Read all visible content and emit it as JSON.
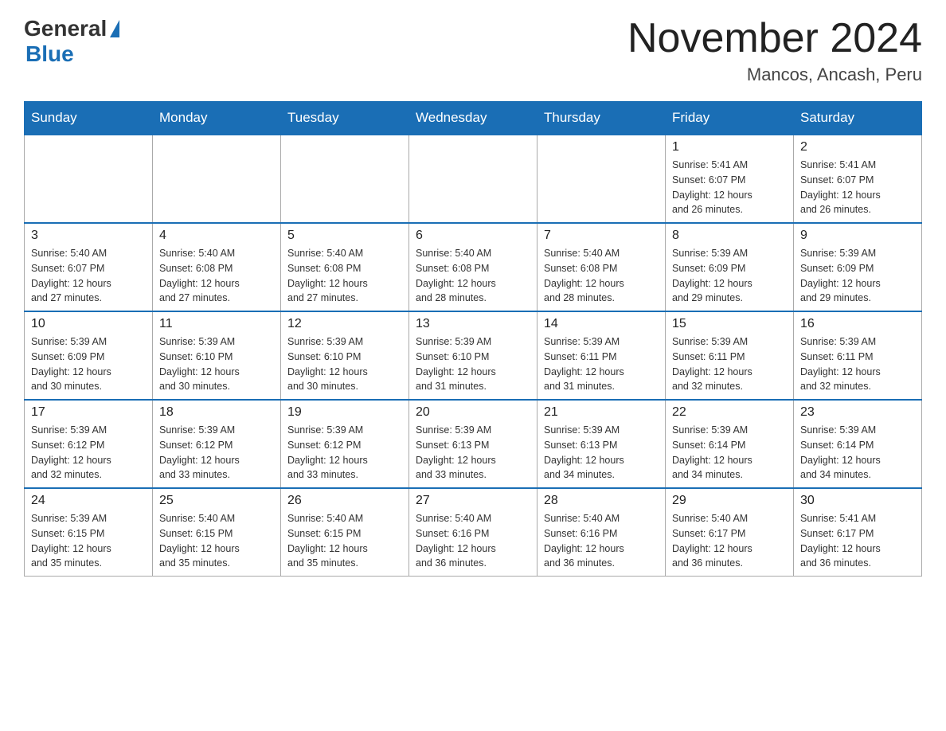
{
  "header": {
    "logo_general": "General",
    "logo_blue": "Blue",
    "month_title": "November 2024",
    "location": "Mancos, Ancash, Peru"
  },
  "days_of_week": [
    "Sunday",
    "Monday",
    "Tuesday",
    "Wednesday",
    "Thursday",
    "Friday",
    "Saturday"
  ],
  "weeks": [
    [
      {
        "day": "",
        "info": ""
      },
      {
        "day": "",
        "info": ""
      },
      {
        "day": "",
        "info": ""
      },
      {
        "day": "",
        "info": ""
      },
      {
        "day": "",
        "info": ""
      },
      {
        "day": "1",
        "info": "Sunrise: 5:41 AM\nSunset: 6:07 PM\nDaylight: 12 hours\nand 26 minutes."
      },
      {
        "day": "2",
        "info": "Sunrise: 5:41 AM\nSunset: 6:07 PM\nDaylight: 12 hours\nand 26 minutes."
      }
    ],
    [
      {
        "day": "3",
        "info": "Sunrise: 5:40 AM\nSunset: 6:07 PM\nDaylight: 12 hours\nand 27 minutes."
      },
      {
        "day": "4",
        "info": "Sunrise: 5:40 AM\nSunset: 6:08 PM\nDaylight: 12 hours\nand 27 minutes."
      },
      {
        "day": "5",
        "info": "Sunrise: 5:40 AM\nSunset: 6:08 PM\nDaylight: 12 hours\nand 27 minutes."
      },
      {
        "day": "6",
        "info": "Sunrise: 5:40 AM\nSunset: 6:08 PM\nDaylight: 12 hours\nand 28 minutes."
      },
      {
        "day": "7",
        "info": "Sunrise: 5:40 AM\nSunset: 6:08 PM\nDaylight: 12 hours\nand 28 minutes."
      },
      {
        "day": "8",
        "info": "Sunrise: 5:39 AM\nSunset: 6:09 PM\nDaylight: 12 hours\nand 29 minutes."
      },
      {
        "day": "9",
        "info": "Sunrise: 5:39 AM\nSunset: 6:09 PM\nDaylight: 12 hours\nand 29 minutes."
      }
    ],
    [
      {
        "day": "10",
        "info": "Sunrise: 5:39 AM\nSunset: 6:09 PM\nDaylight: 12 hours\nand 30 minutes."
      },
      {
        "day": "11",
        "info": "Sunrise: 5:39 AM\nSunset: 6:10 PM\nDaylight: 12 hours\nand 30 minutes."
      },
      {
        "day": "12",
        "info": "Sunrise: 5:39 AM\nSunset: 6:10 PM\nDaylight: 12 hours\nand 30 minutes."
      },
      {
        "day": "13",
        "info": "Sunrise: 5:39 AM\nSunset: 6:10 PM\nDaylight: 12 hours\nand 31 minutes."
      },
      {
        "day": "14",
        "info": "Sunrise: 5:39 AM\nSunset: 6:11 PM\nDaylight: 12 hours\nand 31 minutes."
      },
      {
        "day": "15",
        "info": "Sunrise: 5:39 AM\nSunset: 6:11 PM\nDaylight: 12 hours\nand 32 minutes."
      },
      {
        "day": "16",
        "info": "Sunrise: 5:39 AM\nSunset: 6:11 PM\nDaylight: 12 hours\nand 32 minutes."
      }
    ],
    [
      {
        "day": "17",
        "info": "Sunrise: 5:39 AM\nSunset: 6:12 PM\nDaylight: 12 hours\nand 32 minutes."
      },
      {
        "day": "18",
        "info": "Sunrise: 5:39 AM\nSunset: 6:12 PM\nDaylight: 12 hours\nand 33 minutes."
      },
      {
        "day": "19",
        "info": "Sunrise: 5:39 AM\nSunset: 6:12 PM\nDaylight: 12 hours\nand 33 minutes."
      },
      {
        "day": "20",
        "info": "Sunrise: 5:39 AM\nSunset: 6:13 PM\nDaylight: 12 hours\nand 33 minutes."
      },
      {
        "day": "21",
        "info": "Sunrise: 5:39 AM\nSunset: 6:13 PM\nDaylight: 12 hours\nand 34 minutes."
      },
      {
        "day": "22",
        "info": "Sunrise: 5:39 AM\nSunset: 6:14 PM\nDaylight: 12 hours\nand 34 minutes."
      },
      {
        "day": "23",
        "info": "Sunrise: 5:39 AM\nSunset: 6:14 PM\nDaylight: 12 hours\nand 34 minutes."
      }
    ],
    [
      {
        "day": "24",
        "info": "Sunrise: 5:39 AM\nSunset: 6:15 PM\nDaylight: 12 hours\nand 35 minutes."
      },
      {
        "day": "25",
        "info": "Sunrise: 5:40 AM\nSunset: 6:15 PM\nDaylight: 12 hours\nand 35 minutes."
      },
      {
        "day": "26",
        "info": "Sunrise: 5:40 AM\nSunset: 6:15 PM\nDaylight: 12 hours\nand 35 minutes."
      },
      {
        "day": "27",
        "info": "Sunrise: 5:40 AM\nSunset: 6:16 PM\nDaylight: 12 hours\nand 36 minutes."
      },
      {
        "day": "28",
        "info": "Sunrise: 5:40 AM\nSunset: 6:16 PM\nDaylight: 12 hours\nand 36 minutes."
      },
      {
        "day": "29",
        "info": "Sunrise: 5:40 AM\nSunset: 6:17 PM\nDaylight: 12 hours\nand 36 minutes."
      },
      {
        "day": "30",
        "info": "Sunrise: 5:41 AM\nSunset: 6:17 PM\nDaylight: 12 hours\nand 36 minutes."
      }
    ]
  ]
}
